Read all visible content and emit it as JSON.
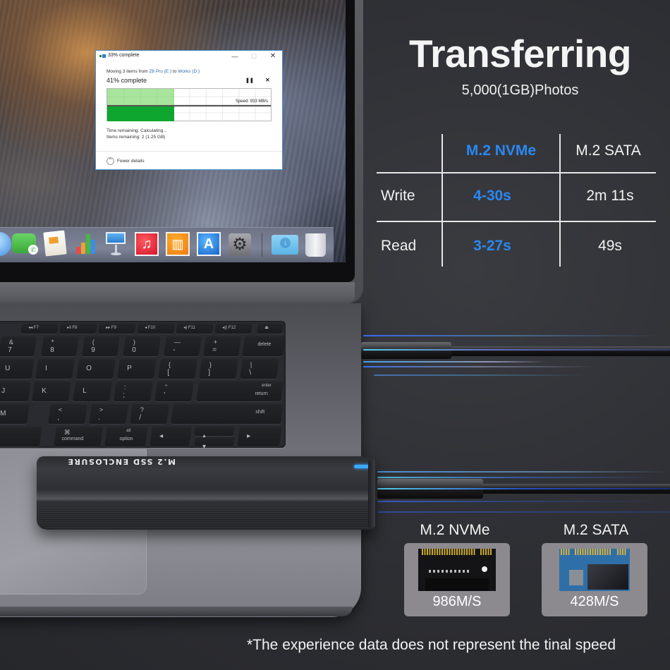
{
  "copy_dialog": {
    "title": "33% complete",
    "moving_prefix": "Moving 3 items from ",
    "source": "Z8 Pro  (E:)",
    "to_word": " to ",
    "destination": "Works (D:)",
    "percent_label": "41% complete",
    "progress_fraction": 0.41,
    "speed": "Speed: 933 MB/s",
    "time_remaining": "Time remaining:  Calculating...",
    "items_remaining": "Items remaining:  2 (1.25 GB)",
    "fewer_details": "Fewer details",
    "pause_icon": "pause-icon",
    "cancel_icon": "close-icon",
    "window_buttons": {
      "minimize": "—",
      "maximize": "☐",
      "close": "✕"
    }
  },
  "dock": {
    "items": [
      "messages",
      "facetime",
      "pages",
      "numbers",
      "keynote",
      "itunes",
      "ibooks",
      "app-store",
      "system-preferences",
      "downloads",
      "trash"
    ],
    "glyphs": {
      "itunes": "♫",
      "ibooks": "📖",
      "appstore": "A",
      "prefs": "⚙",
      "facetime_phone": "✆"
    }
  },
  "keyboard": {
    "fkeys": [
      "◂◂ F7",
      "▸ǁ F8",
      "▸▸ F9",
      "◂ F10",
      "◂) F11",
      "◂)) F12",
      "⏏"
    ],
    "row_num": [
      [
        "&",
        "7"
      ],
      [
        "*",
        "8"
      ],
      [
        "(",
        "9"
      ],
      [
        ")",
        "0"
      ],
      [
        "—",
        "-"
      ],
      [
        "+",
        "="
      ],
      [
        "",
        "delete"
      ]
    ],
    "row_top": [
      [
        "",
        "U"
      ],
      [
        "",
        "I"
      ],
      [
        "",
        "O"
      ],
      [
        "",
        "P"
      ],
      [
        "{",
        "["
      ],
      [
        "}",
        "]"
      ],
      [
        "|",
        "\\"
      ]
    ],
    "row_home": [
      [
        "",
        "J"
      ],
      [
        "",
        "K"
      ],
      [
        "",
        "L"
      ],
      [
        ":",
        ";"
      ],
      [
        "\"",
        "'"
      ],
      [
        "enter",
        "return"
      ]
    ],
    "row_bottom": [
      [
        "",
        "M"
      ],
      [
        "<",
        ","
      ],
      [
        ">",
        "."
      ],
      [
        "?",
        "/"
      ],
      [
        "",
        "shift"
      ]
    ],
    "row_mod": [
      [
        "⌘",
        "command"
      ],
      [
        "alt",
        "option"
      ],
      [
        "",
        "◂"
      ],
      [
        "▴",
        "▾"
      ],
      [
        "",
        "▸"
      ]
    ]
  },
  "ssd": {
    "label": "M.2 SSD ENCLOSURE",
    "led_color": "#3aa8ff"
  },
  "headline": {
    "title": "Transferring",
    "subtitle": "5,000(1GB)Photos"
  },
  "comparison_table": {
    "columns": [
      "",
      "M.2 NVMe",
      "M.2 SATA"
    ],
    "rows": [
      {
        "label": "Write",
        "nvme": "4-30s",
        "sata": "2m 11s"
      },
      {
        "label": "Read",
        "nvme": "3-27s",
        "sata": "49s"
      }
    ],
    "highlight_color": "#2a88f2"
  },
  "cards": [
    {
      "title": "M.2 NVMe",
      "speed": "986M/S",
      "image": "nvme-ssd-board"
    },
    {
      "title": "M.2 SATA",
      "speed": "428M/S",
      "image": "sata-ssd-board"
    }
  ],
  "footnote": "*The experience data does not represent the tinal speed"
}
